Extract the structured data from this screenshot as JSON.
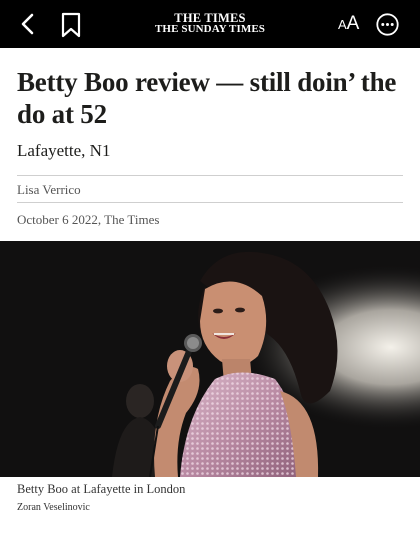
{
  "toolbar": {
    "back_icon": "chevron-left-icon",
    "bookmark_icon": "bookmark-icon",
    "masthead_line1": "THE TIMES",
    "masthead_line2": "THE SUNDAY TIMES",
    "font_size_small": "A",
    "font_size_large": "A",
    "more_icon": "more-horizontal-icon"
  },
  "article": {
    "headline": "Betty Boo review — still doin’ the do at 52",
    "standfirst": "Lafayette, N1",
    "author": "Lisa Verrico",
    "date_source": "October 6 2022, The Times",
    "image": {
      "caption": "Betty Boo at Lafayette in London",
      "credit": "Zoran Veselinovic"
    }
  },
  "colors": {
    "toolbar_bg": "#000000",
    "text": "#1d1d1b",
    "meta_text": "#555555",
    "rule": "#cfcfcf"
  }
}
